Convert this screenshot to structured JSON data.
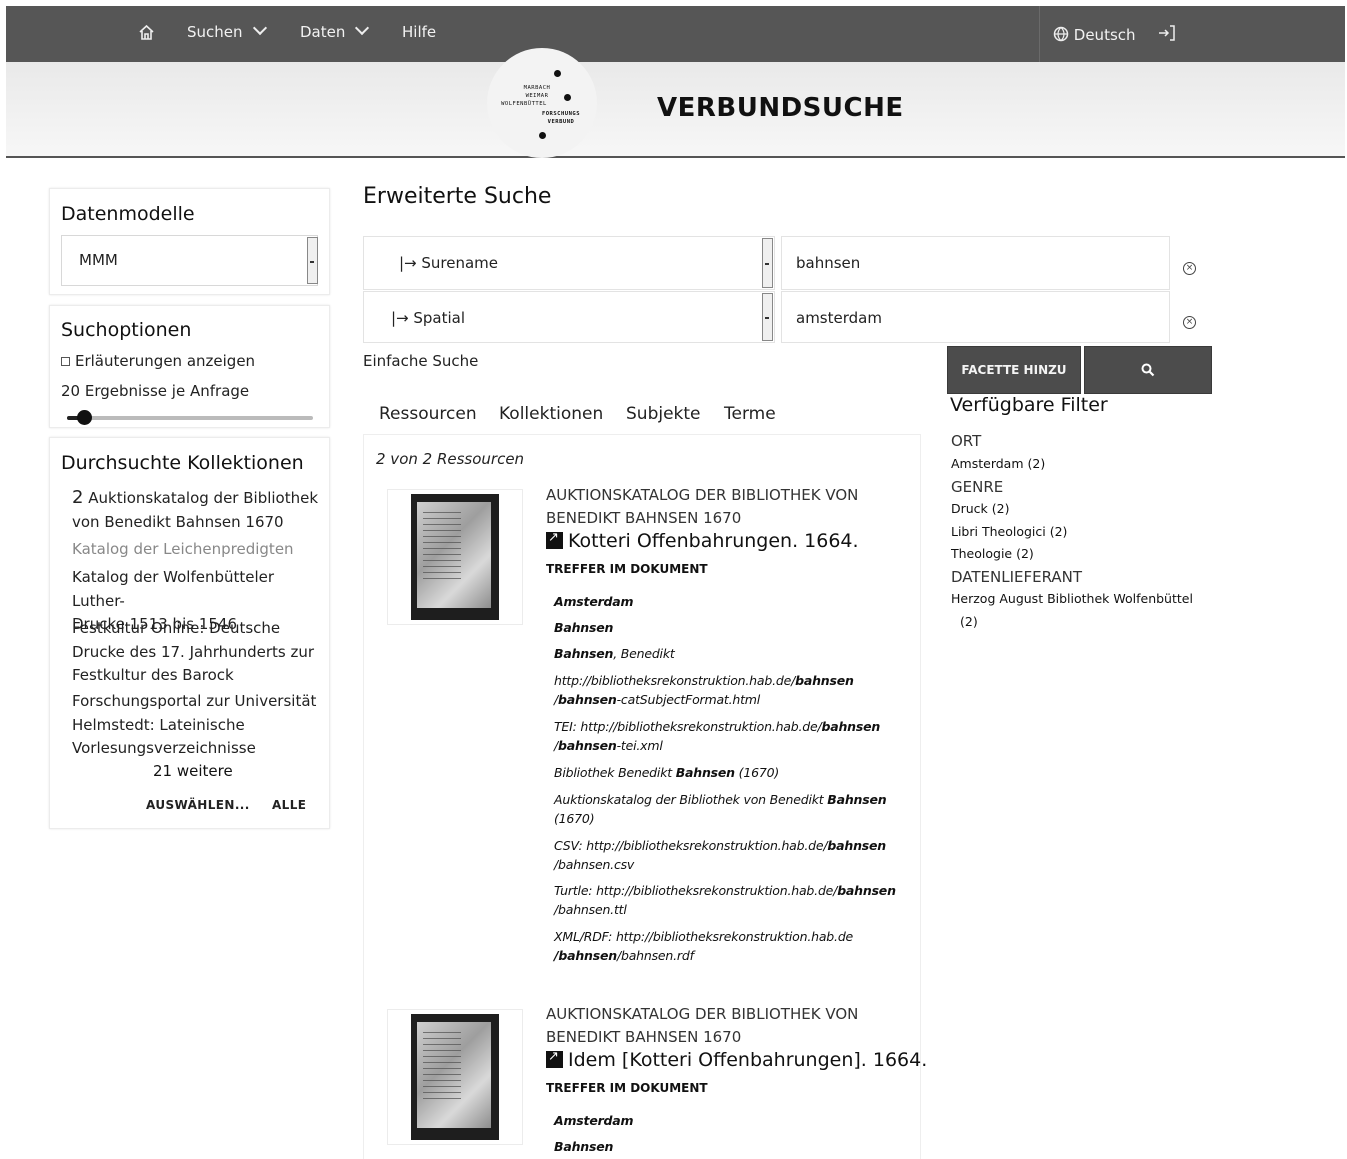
{
  "nav": {
    "search": "Suchen",
    "data": "Daten",
    "help": "Hilfe",
    "language": "Deutsch"
  },
  "logo": {
    "line1": "MARBACH",
    "line2": "WEIMAR",
    "line3": "WOLFENBÜTTEL",
    "line4": "FORSCHUNGS",
    "line5": "VERBUND"
  },
  "header": {
    "title": "VERBUNDSUCHE"
  },
  "sidebar": {
    "datamodels": {
      "title": "Datenmodelle",
      "selected": "MMM"
    },
    "searchoptions": {
      "title": "Suchoptionen",
      "explain_label": "Erläuterungen anzeigen",
      "per_page_label": "20 Ergebnisse je Anfrage",
      "per_page_value": 0.07
    },
    "collections": {
      "title": "Durchsuchte Kollektionen",
      "items": [
        {
          "count": "2",
          "line1": "Auktionskatalog der Bibliothek",
          "line2": "von Benedikt Bahnsen 1670"
        },
        {
          "line1": "Katalog der Leichenpredigten"
        },
        {
          "line1": "Katalog der Wolfenbütteler Luther-",
          "line2": "Drucke 1513 bis 1546"
        },
        {
          "line1": "Festkultur Online: Deutsche",
          "line2": "Drucke des 17. Jahrhunderts zur",
          "line3": "Festkultur des Barock"
        },
        {
          "line1": "Forschungsportal zur Universität",
          "line2": "Helmstedt: Lateinische",
          "line3": "Vorlesungsverzeichnisse"
        }
      ],
      "more": "21 weitere",
      "select_btn": "AUSWÄHLEN...",
      "all_btn": "ALLE"
    }
  },
  "main": {
    "title": "Erweiterte Suche",
    "criteria": [
      {
        "field": "|→ Surename",
        "value": "bahnsen"
      },
      {
        "field": "|→ Spatial",
        "value": "amsterdam"
      }
    ],
    "simple_search": "Einfache Suche",
    "add_facet": "FACETTE HINZU",
    "tabs": [
      "Ressourcen",
      "Kollektionen",
      "Subjekte",
      "Terme"
    ],
    "result_count": "2 von 2 Ressourcen",
    "results": [
      {
        "coll_line1": "AUKTIONSKATALOG DER BIBLIOTHEK VON",
        "coll_line2": "BENEDIKT BAHNSEN 1670",
        "title": "Kotteri Offenbahrungen. 1664.",
        "hits_label": "TREFFER IM DOKUMENT"
      },
      {
        "coll_line1": "AUKTIONSKATALOG DER BIBLIOTHEK VON",
        "coll_line2": "BENEDIKT BAHNSEN 1670",
        "title": "Idem [Kotteri Offenbahrungen]. 1664.",
        "hits_label": "TREFFER IM DOKUMENT"
      }
    ],
    "hits1": {
      "h1": "Amsterdam",
      "h2": "Bahnsen",
      "h3a": "Bahnsen",
      "h3b": ", Benedikt",
      "h4a": "http://bibliotheksrekonstruktion.hab.de/",
      "h4b": "bahnsen",
      "h4c": "/",
      "h4d": "bahnsen",
      "h4e": "-catSubjectFormat.html",
      "h5a": "TEI: http://bibliotheksrekonstruktion.hab.de/",
      "h5b": "bahnsen",
      "h5c": "/",
      "h5d": "bahnsen",
      "h5e": "-tei.xml",
      "h6a": "Bibliothek Benedikt ",
      "h6b": "Bahnsen",
      "h6c": " (1670)",
      "h7a": "Auktionskatalog der Bibliothek von Benedikt ",
      "h7b": "Bahnsen",
      "h7c": "(1670)",
      "h8a": "CSV: http://bibliotheksrekonstruktion.hab.de/",
      "h8b": "bahnsen",
      "h8c": "/bahnsen.csv",
      "h9a": "Turtle: http://bibliotheksrekonstruktion.hab.de/",
      "h9b": "bahnsen",
      "h9c": "/bahnsen.ttl",
      "h10a": "XML/RDF: http://bibliotheksrekonstruktion.hab.de",
      "h10b": "/bahnsen",
      "h10c": "/bahnsen.rdf"
    },
    "hits2": {
      "h1": "Amsterdam",
      "h2": "Bahnsen"
    }
  },
  "filters": {
    "title": "Verfügbare Filter",
    "ort": "ORT",
    "ort_items": [
      "Amsterdam (2)"
    ],
    "genre": "GENRE",
    "genre_items": [
      "Druck (2)",
      "Libri Theologici (2)",
      "Theologie (2)"
    ],
    "provider": "DATENLIEFERANT",
    "provider_line1": "Herzog August Bibliothek Wolfenbüttel",
    "provider_line2": "(2)"
  }
}
